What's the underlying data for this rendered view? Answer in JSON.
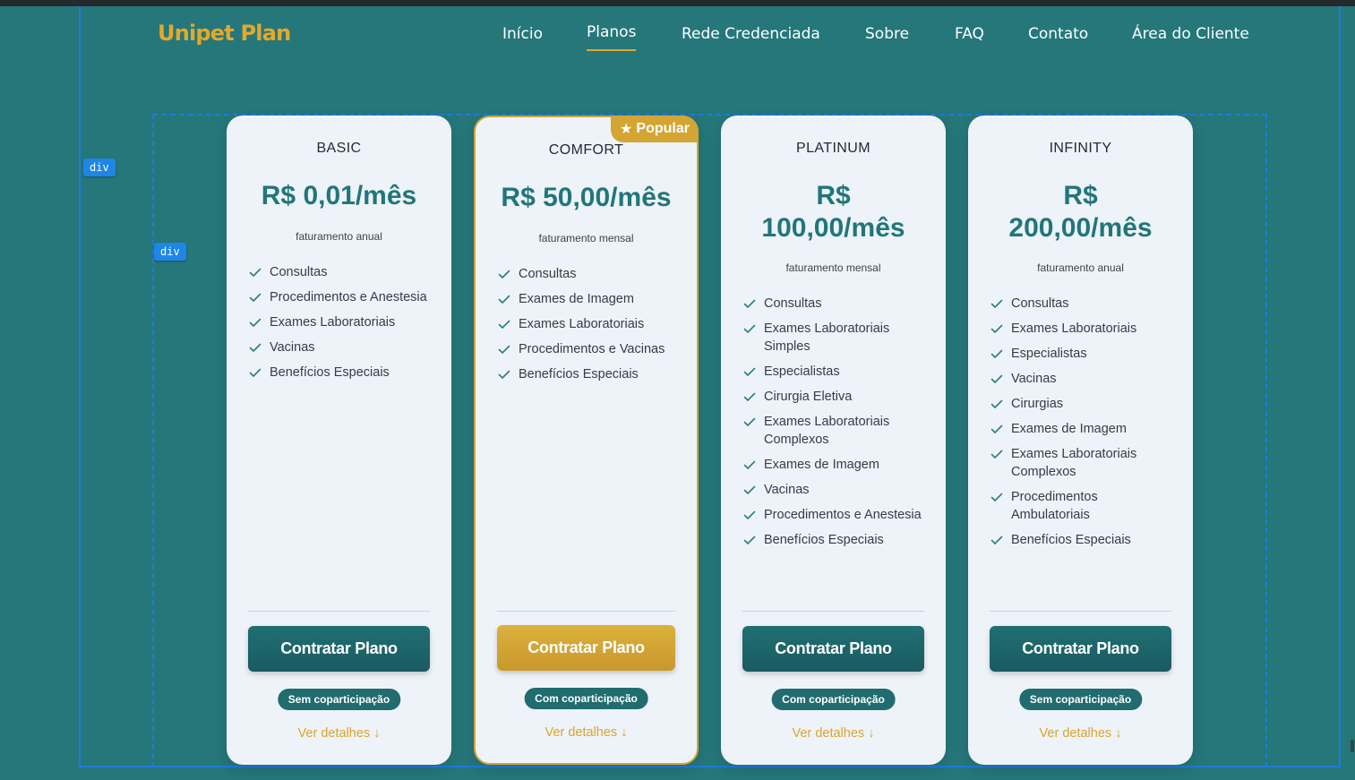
{
  "brand": {
    "logo": "Unipet Plan"
  },
  "nav": {
    "items": [
      {
        "label": "Início"
      },
      {
        "label": "Planos",
        "active": true
      },
      {
        "label": "Rede Credenciada"
      },
      {
        "label": "Sobre"
      },
      {
        "label": "FAQ"
      },
      {
        "label": "Contato"
      },
      {
        "label": "Área do Cliente"
      }
    ]
  },
  "devtools": {
    "outer_tag": "div",
    "inner_tag": "div"
  },
  "plans": [
    {
      "name": "BASIC",
      "price": "R$ 0,01/mês",
      "billing": "faturamento anual",
      "features": [
        "Consultas",
        "Procedimentos e Anestesia",
        "Exames Laboratoriais",
        "Vacinas",
        "Benefícios Especiais"
      ],
      "cta": "Contratar Plano",
      "copay": "Sem coparticipação",
      "details": "Ver detalhes ↓"
    },
    {
      "name": "COMFORT",
      "price": "R$ 50,00/mês",
      "billing": "faturamento mensal",
      "badge": "Popular",
      "features": [
        "Consultas",
        "Exames de Imagem",
        "Exames Laboratoriais",
        "Procedimentos e Vacinas",
        "Benefícios Especiais"
      ],
      "cta": "Contratar Plano",
      "copay": "Com coparticipação",
      "details": "Ver detalhes ↓"
    },
    {
      "name": "PLATINUM",
      "price": "R$ 100,00/mês",
      "billing": "faturamento mensal",
      "features": [
        "Consultas",
        "Exames Laboratoriais Simples",
        "Especialistas",
        "Cirurgia Eletiva",
        "Exames Laboratoriais Complexos",
        "Exames de Imagem",
        "Vacinas",
        "Procedimentos e Anestesia",
        "Benefícios Especiais"
      ],
      "cta": "Contratar Plano",
      "copay": "Com coparticipação",
      "details": "Ver detalhes ↓"
    },
    {
      "name": "INFINITY",
      "price": "R$ 200,00/mês",
      "billing": "faturamento anual",
      "features": [
        "Consultas",
        "Exames Laboratoriais",
        "Especialistas",
        "Vacinas",
        "Cirurgias",
        "Exames de Imagem",
        "Exames Laboratoriais Complexos",
        "Procedimentos Ambulatoriais",
        "Benefícios Especiais"
      ],
      "cta": "Contratar Plano",
      "copay": "Sem coparticipação",
      "details": "Ver detalhes ↓"
    }
  ],
  "colors": {
    "background": "#25777a",
    "accent_gold": "#d4a533",
    "primary_teal": "#1f6f73",
    "card_bg": "#eef3f9"
  }
}
